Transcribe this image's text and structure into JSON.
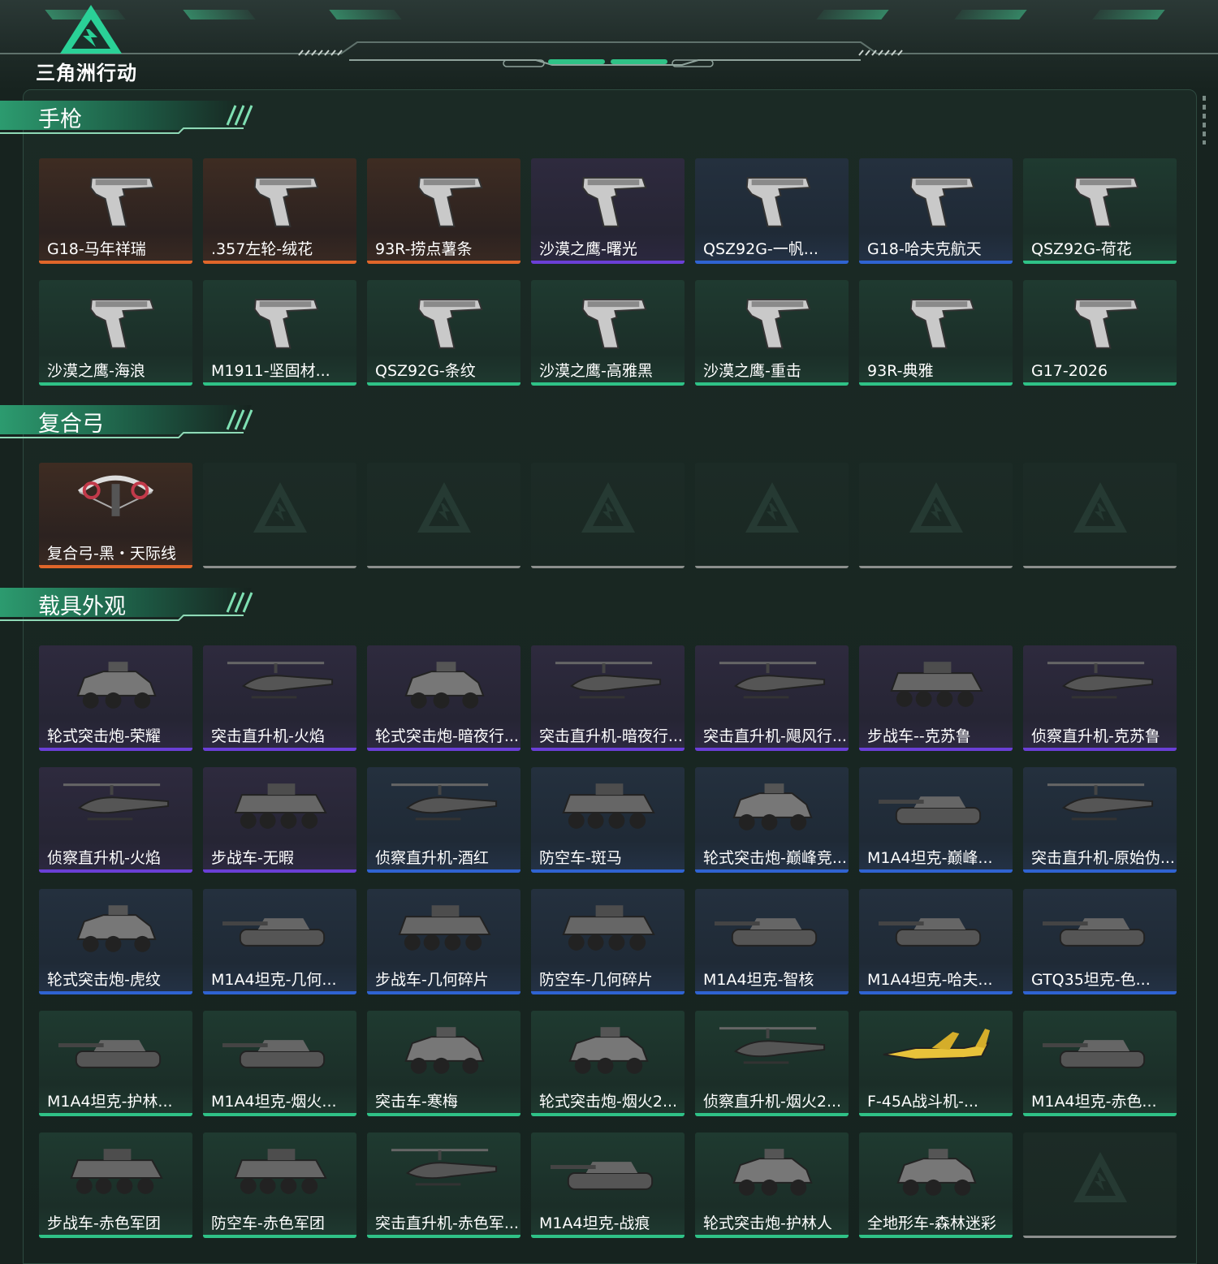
{
  "header": {
    "logo_text": "三角洲行动"
  },
  "colors": {
    "orange": "#e0662a",
    "purple": "#6a3fd6",
    "blue": "#2f63d2",
    "green": "#2fc287",
    "accent": "#2fc287"
  },
  "sections": [
    {
      "title": "手枪",
      "items": [
        {
          "label": "G18-马年祥瑞",
          "rarity": "orange",
          "kind": "pistol"
        },
        {
          "label": ".357左轮-绒花",
          "rarity": "orange",
          "kind": "pistol"
        },
        {
          "label": "93R-捞点薯条",
          "rarity": "orange",
          "kind": "pistol"
        },
        {
          "label": "沙漠之鹰-曙光",
          "rarity": "purple",
          "kind": "pistol"
        },
        {
          "label": "QSZ92G-一帆...",
          "rarity": "blue",
          "kind": "pistol"
        },
        {
          "label": "G18-哈夫克航天",
          "rarity": "blue",
          "kind": "pistol"
        },
        {
          "label": "QSZ92G-荷花",
          "rarity": "green",
          "kind": "pistol"
        },
        {
          "label": "沙漠之鹰-海浪",
          "rarity": "green",
          "kind": "pistol"
        },
        {
          "label": "M1911-坚固材...",
          "rarity": "green",
          "kind": "pistol"
        },
        {
          "label": "QSZ92G-条纹",
          "rarity": "green",
          "kind": "pistol"
        },
        {
          "label": "沙漠之鹰-高雅黑",
          "rarity": "green",
          "kind": "pistol"
        },
        {
          "label": "沙漠之鹰-重击",
          "rarity": "green",
          "kind": "pistol"
        },
        {
          "label": "93R-典雅",
          "rarity": "green",
          "kind": "pistol"
        },
        {
          "label": "G17-2026",
          "rarity": "green",
          "kind": "pistol"
        }
      ]
    },
    {
      "title": "复合弓",
      "items": [
        {
          "label": "复合弓-黑・天际线",
          "rarity": "orange",
          "kind": "bow"
        },
        {
          "label": "",
          "rarity": "empty",
          "kind": "empty"
        },
        {
          "label": "",
          "rarity": "empty",
          "kind": "empty"
        },
        {
          "label": "",
          "rarity": "empty",
          "kind": "empty"
        },
        {
          "label": "",
          "rarity": "empty",
          "kind": "empty"
        },
        {
          "label": "",
          "rarity": "empty",
          "kind": "empty"
        },
        {
          "label": "",
          "rarity": "empty",
          "kind": "empty"
        }
      ]
    },
    {
      "title": "载具外观",
      "items": [
        {
          "label": "轮式突击炮-荣耀",
          "rarity": "purple",
          "kind": "vehicle"
        },
        {
          "label": "突击直升机-火焰",
          "rarity": "purple",
          "kind": "heli"
        },
        {
          "label": "轮式突击炮-暗夜行...",
          "rarity": "purple",
          "kind": "vehicle"
        },
        {
          "label": "突击直升机-暗夜行...",
          "rarity": "purple",
          "kind": "heli"
        },
        {
          "label": "突击直升机-飓风行...",
          "rarity": "purple",
          "kind": "heli"
        },
        {
          "label": "步战车--克苏鲁",
          "rarity": "purple",
          "kind": "apc"
        },
        {
          "label": "侦察直升机-克苏鲁",
          "rarity": "purple",
          "kind": "heli"
        },
        {
          "label": "侦察直升机-火焰",
          "rarity": "purple",
          "kind": "heli"
        },
        {
          "label": "步战车-无暇",
          "rarity": "purple",
          "kind": "apc"
        },
        {
          "label": "侦察直升机-酒红",
          "rarity": "blue",
          "kind": "heli"
        },
        {
          "label": "防空车-斑马",
          "rarity": "blue",
          "kind": "apc"
        },
        {
          "label": "轮式突击炮-巅峰竞...",
          "rarity": "blue",
          "kind": "vehicle"
        },
        {
          "label": "M1A4坦克-巅峰...",
          "rarity": "blue",
          "kind": "tank"
        },
        {
          "label": "突击直升机-原始伪...",
          "rarity": "blue",
          "kind": "heli"
        },
        {
          "label": "轮式突击炮-虎纹",
          "rarity": "blue",
          "kind": "vehicle"
        },
        {
          "label": "M1A4坦克-几何...",
          "rarity": "blue",
          "kind": "tank"
        },
        {
          "label": "步战车-几何碎片",
          "rarity": "blue",
          "kind": "apc"
        },
        {
          "label": "防空车-几何碎片",
          "rarity": "blue",
          "kind": "apc"
        },
        {
          "label": "M1A4坦克-智核",
          "rarity": "blue",
          "kind": "tank"
        },
        {
          "label": "M1A4坦克-哈夫...",
          "rarity": "blue",
          "kind": "tank"
        },
        {
          "label": "GTQ35坦克-色...",
          "rarity": "blue",
          "kind": "tank"
        },
        {
          "label": "M1A4坦克-护林...",
          "rarity": "green",
          "kind": "tank"
        },
        {
          "label": "M1A4坦克-烟火...",
          "rarity": "green",
          "kind": "tank"
        },
        {
          "label": "突击车-寒梅",
          "rarity": "green",
          "kind": "vehicle"
        },
        {
          "label": "轮式突击炮-烟火2...",
          "rarity": "green",
          "kind": "vehicle"
        },
        {
          "label": "侦察直升机-烟火2...",
          "rarity": "green",
          "kind": "heli"
        },
        {
          "label": "F-45A战斗机-...",
          "rarity": "green",
          "kind": "jet"
        },
        {
          "label": "M1A4坦克-赤色...",
          "rarity": "green",
          "kind": "tank"
        },
        {
          "label": "步战车-赤色军团",
          "rarity": "green",
          "kind": "apc"
        },
        {
          "label": "防空车-赤色军团",
          "rarity": "green",
          "kind": "apc"
        },
        {
          "label": "突击直升机-赤色军...",
          "rarity": "green",
          "kind": "heli"
        },
        {
          "label": "M1A4坦克-战痕",
          "rarity": "green",
          "kind": "tank"
        },
        {
          "label": "轮式突击炮-护林人",
          "rarity": "green",
          "kind": "vehicle"
        },
        {
          "label": "全地形车-森林迷彩",
          "rarity": "green",
          "kind": "vehicle"
        },
        {
          "label": "",
          "rarity": "empty",
          "kind": "empty"
        }
      ]
    }
  ]
}
